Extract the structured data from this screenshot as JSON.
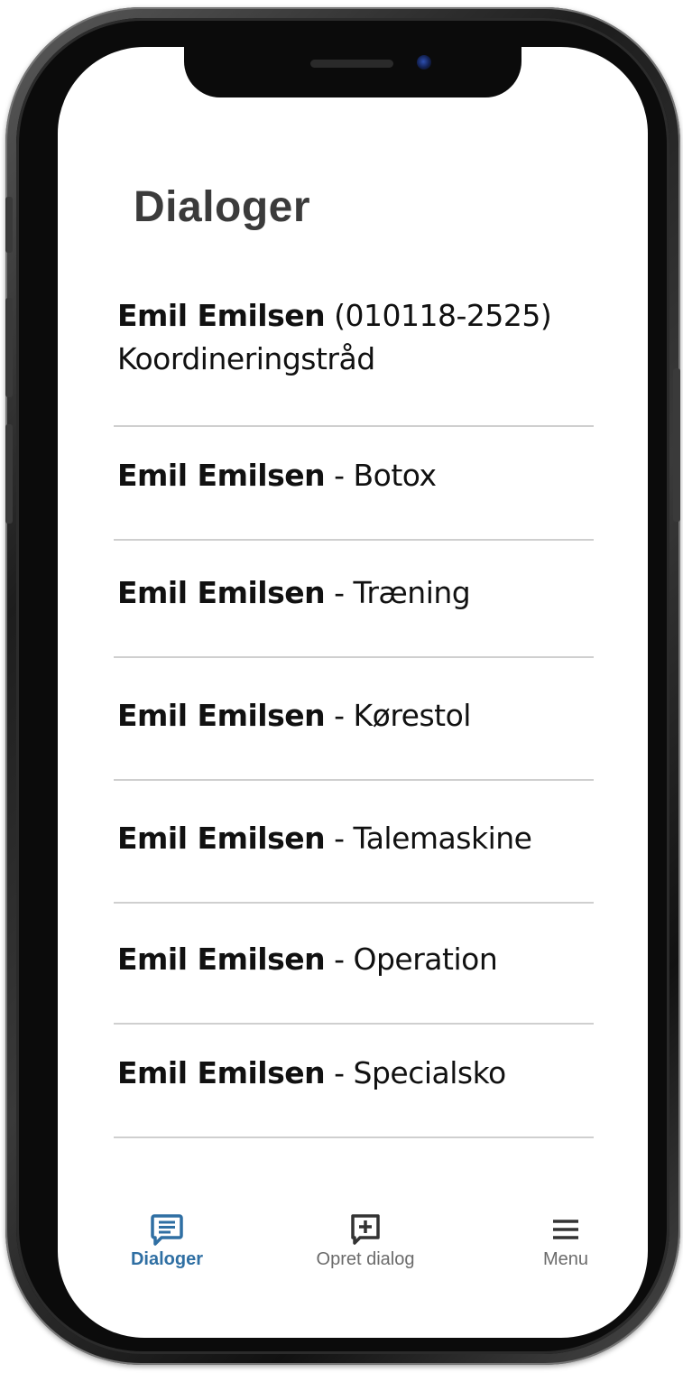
{
  "page_title": "Dialoger",
  "dialogs": [
    {
      "name": "Emil Emilsen",
      "id": "(010118-2525)",
      "subtitle": "Koordineringstråd"
    },
    {
      "name": "Emil Emilsen",
      "topic": "- Botox"
    },
    {
      "name": "Emil Emilsen",
      "topic": "- Træning"
    },
    {
      "name": "Emil Emilsen",
      "topic": "- Kørestol"
    },
    {
      "name": "Emil Emilsen",
      "topic": "- Talemaskine"
    },
    {
      "name": "Emil Emilsen",
      "topic": "- Operation"
    },
    {
      "name": "Emil Emilsen",
      "topic": "- Specialsko"
    }
  ],
  "tabs": [
    {
      "label": "Dialoger",
      "icon": "chat-bubble-icon",
      "active": true
    },
    {
      "label": "Opret dialog",
      "icon": "add-dialog-icon",
      "active": false
    },
    {
      "label": "Menu",
      "icon": "hamburger-menu-icon",
      "active": false
    }
  ],
  "colors": {
    "accent": "#2f6fa3",
    "title": "#3b3b3b",
    "divider": "#cfcfcf",
    "tab_inactive": "#6b6b6b"
  }
}
